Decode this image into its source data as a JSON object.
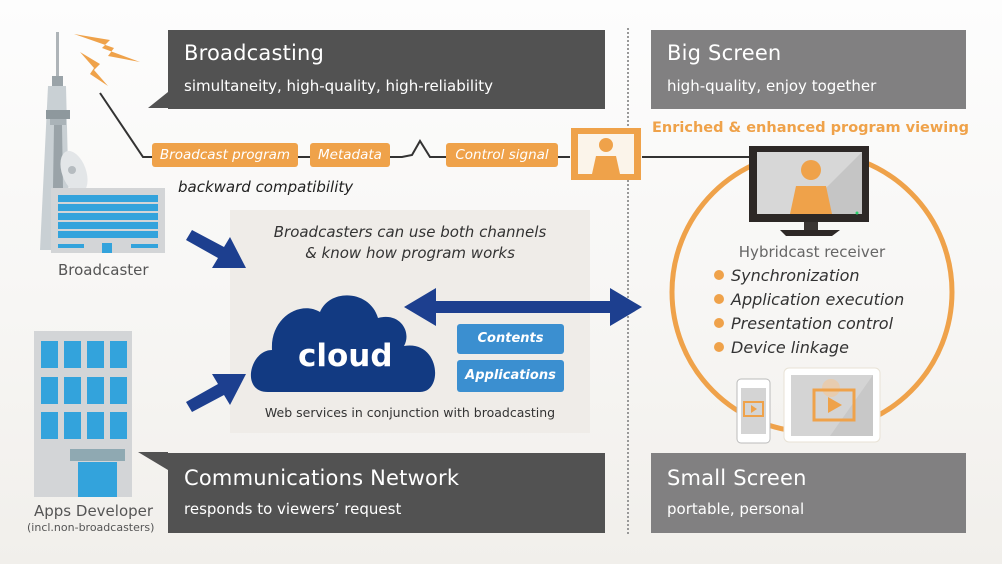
{
  "callouts": {
    "broadcasting": {
      "title": "Broadcasting",
      "subtitle": "simultaneity, high-quality, high-reliability"
    },
    "big_screen": {
      "title": "Big Screen",
      "subtitle": "high-quality, enjoy together"
    },
    "communications": {
      "title": "Communications Network",
      "subtitle": "responds to viewers’ request"
    },
    "small_screen": {
      "title": "Small Screen",
      "subtitle": "portable, personal"
    }
  },
  "signal_tags": [
    "Broadcast program",
    "Metadata",
    "Control signal"
  ],
  "backward_compat": "backward compatibility",
  "enriched_label": "Enriched & enhanced program viewing",
  "actors": {
    "broadcaster": "Broadcaster",
    "apps_developer": "Apps Developer",
    "apps_developer_note": "(incl.non-broadcasters)"
  },
  "cloud_panel": {
    "caption_line1": "Broadcasters can use both channels",
    "caption_line2": "& know how program works",
    "cloud_label": "cloud",
    "buttons": [
      "Contents",
      "Applications"
    ],
    "footer": "Web services  in conjunction with broadcasting"
  },
  "receiver": {
    "title": "Hybridcast receiver",
    "features": [
      "Synchronization",
      "Application execution",
      "Presentation control",
      "Device linkage"
    ]
  },
  "colors": {
    "orange": "#efa24a",
    "navy": "#1d3f8f",
    "dark_callout": "#525252",
    "gray_callout": "#818081",
    "blue_button": "#3b8fd0"
  }
}
